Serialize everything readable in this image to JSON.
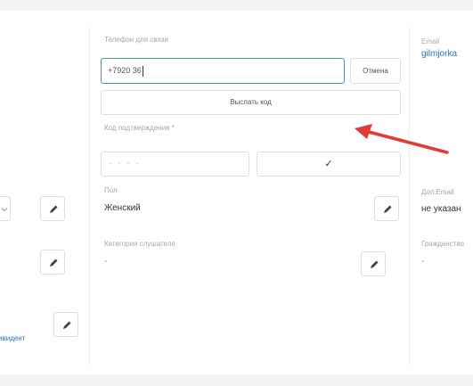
{
  "phone": {
    "label": "Телефон для связи",
    "value": "+7920 36",
    "cancel_label": "Отмена",
    "send_code_label": "Выслать код"
  },
  "confirmation": {
    "label": "Код подтверждения *",
    "placeholder": "- - - -",
    "confirm_glyph": "✓"
  },
  "gender": {
    "label": "Пол",
    "value": "Женский"
  },
  "category": {
    "label": "Категория слушателя",
    "value": "-"
  },
  "email": {
    "label": "Email",
    "value": "gilmjorka"
  },
  "extra_email": {
    "label": "Доп.Email",
    "value": "не указан"
  },
  "citizenship": {
    "label": "Гражданство",
    "value": "-"
  },
  "left_link": {
    "label": "ивидент"
  },
  "colors": {
    "accent": "#4a8de8",
    "link": "#2f6fd0",
    "arrow": "#e53935"
  },
  "icons": {
    "edit": "pencil-icon",
    "check": "check-icon",
    "chevron": "chevron-icon",
    "arrow": "red-arrow-annotation"
  }
}
